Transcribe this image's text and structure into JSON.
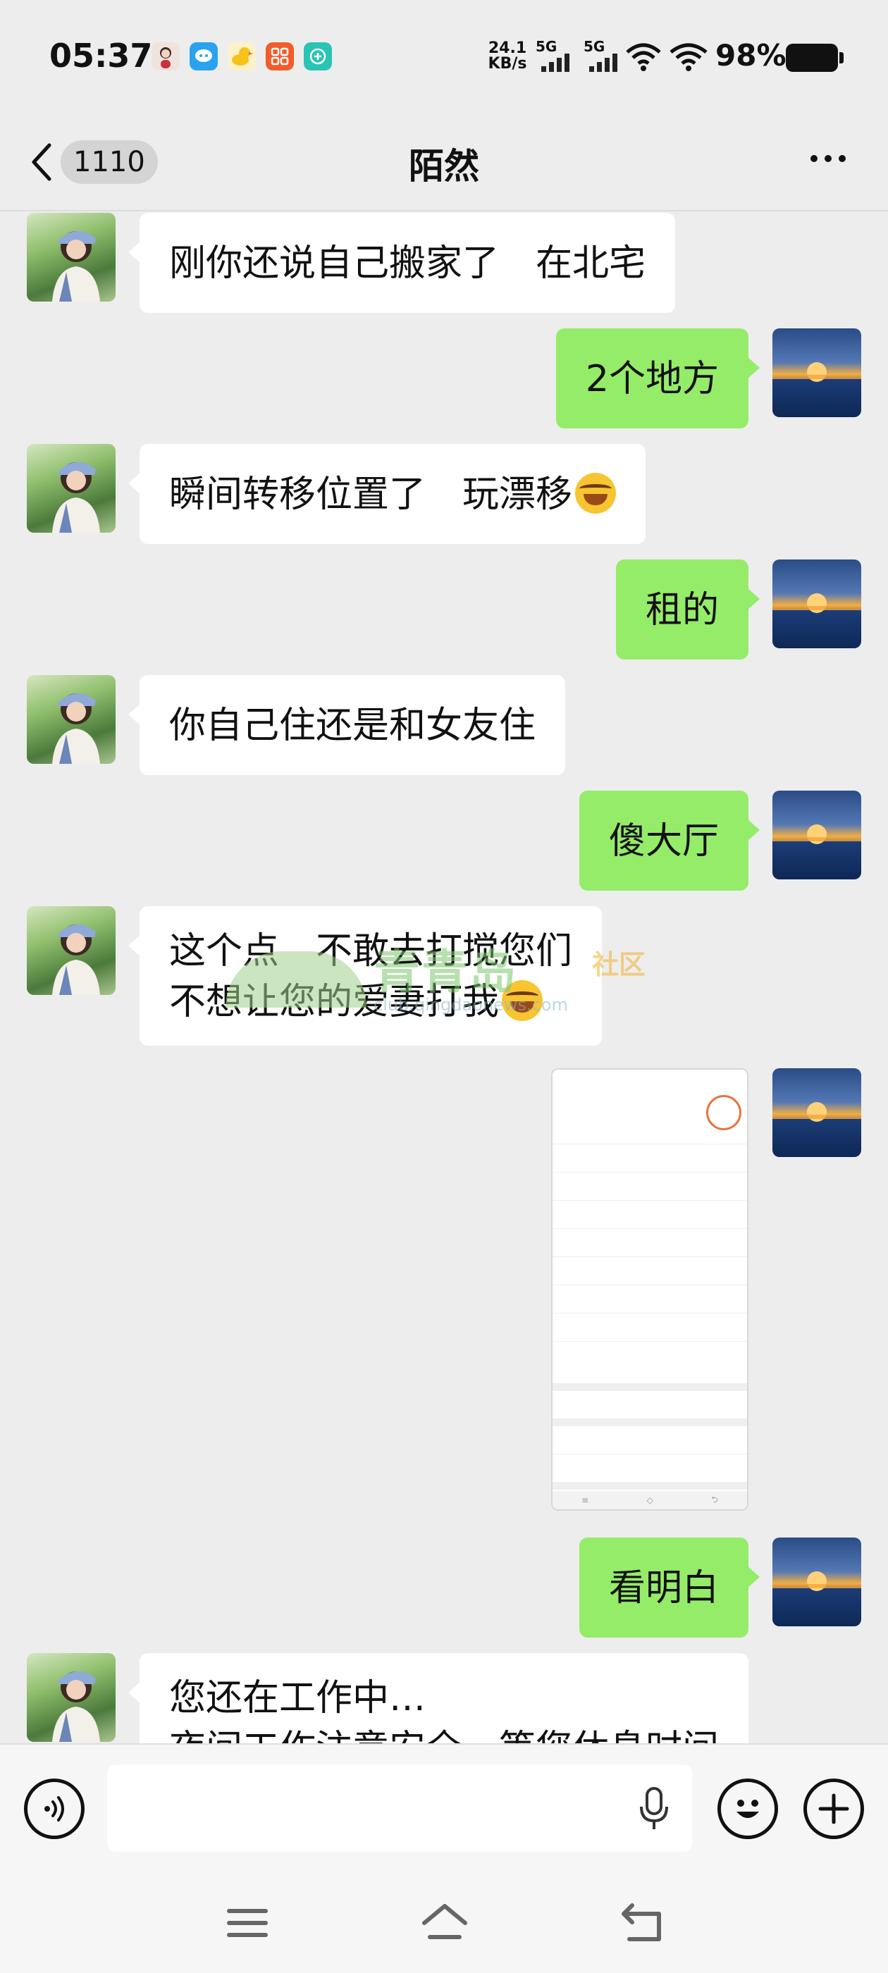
{
  "status_bar": {
    "time": "05:37",
    "net_speed_value": "24.1",
    "net_speed_unit": "KB/s",
    "signal_1_label": "5G",
    "signal_2_label": "5G",
    "battery_text": "98%"
  },
  "header": {
    "unread_count": "1110",
    "title": "陌然"
  },
  "messages": [
    {
      "side": "left",
      "lines": [
        "刚你还说自己搬家了　在北宅"
      ]
    },
    {
      "side": "right",
      "lines": [
        "2个地方"
      ]
    },
    {
      "side": "left",
      "lines": [
        "瞬间转移位置了　玩漂移"
      ],
      "emoji": "grin-sweat-emoji"
    },
    {
      "side": "right",
      "lines": [
        "租的"
      ]
    },
    {
      "side": "left",
      "lines": [
        "你自己住还是和女友住"
      ]
    },
    {
      "side": "right",
      "lines": [
        "傻大厅"
      ]
    },
    {
      "side": "left",
      "lines": [
        "这个点　不敢去打搅您们",
        "不想让您的爱妻打我"
      ],
      "emoji": "grin-sweat-emoji"
    },
    {
      "side": "right",
      "type": "image"
    },
    {
      "side": "right",
      "lines": [
        "看明白"
      ]
    },
    {
      "side": "left",
      "lines": [
        "您还在工作中…",
        "夜间工作注意安全　等您休息时间"
      ]
    }
  ],
  "watermark": {
    "main": "青青岛",
    "sub": "社区",
    "url": "club.qingdaonews.com"
  },
  "input": {
    "value": "",
    "placeholder": ""
  },
  "icons": {
    "voice": "voice-mode-icon",
    "mic": "microphone-icon",
    "emoji": "emoji-icon",
    "plus": "plus-icon",
    "menu": "menu-icon",
    "home": "home-icon",
    "back": "back-icon"
  },
  "colors": {
    "background": "#ededed",
    "bubble_self": "#95ec69",
    "bubble_other": "#ffffff"
  }
}
